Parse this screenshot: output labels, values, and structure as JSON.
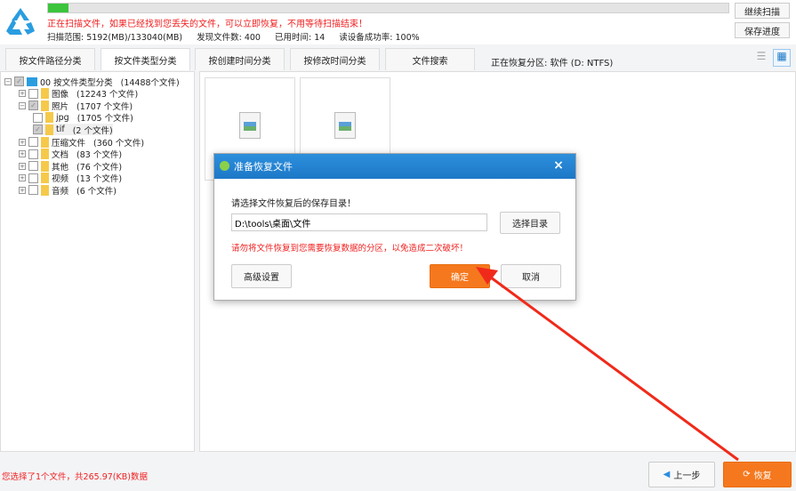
{
  "header": {
    "progress_percent": 3,
    "message": "正在扫描文件，如果已经找到您丢失的文件，可以立即恢复，不用等待扫描结束！",
    "stats": [
      "扫描范围: 5192(MB)/133040(MB)",
      "发现文件数: 400",
      "已用时间: 14",
      "读设备成功率: 100%"
    ],
    "continue_scan": "继续扫描",
    "save_progress": "保存进度"
  },
  "tabs": [
    "按文件路径分类",
    "按文件类型分类",
    "按创建时间分类",
    "按修改时间分类",
    "文件搜索"
  ],
  "partition": "正在恢复分区: 软件 (D: NTFS)",
  "tree": [
    {
      "label": "00 按文件类型分类",
      "count": "(14488个文件)",
      "level": 0,
      "checked": true
    },
    {
      "label": "图像",
      "count": "(12243 个文件)",
      "level": 1,
      "checked": false
    },
    {
      "label": "照片",
      "count": "(1707 个文件)",
      "level": 1,
      "checked": true
    },
    {
      "label": "jpg",
      "count": "(1705 个文件)",
      "level": 2,
      "checked": false
    },
    {
      "label": "tif",
      "count": "(2 个文件)",
      "level": 2,
      "checked": true
    },
    {
      "label": "压缩文件",
      "count": "(360 个文件)",
      "level": 1,
      "checked": false
    },
    {
      "label": "文档",
      "count": "(83 个文件)",
      "level": 1,
      "checked": false
    },
    {
      "label": "其他",
      "count": "(76 个文件)",
      "level": 1,
      "checked": false
    },
    {
      "label": "视频",
      "count": "(13 个文件)",
      "level": 1,
      "checked": false
    },
    {
      "label": "音频",
      "count": "(6 个文件)",
      "level": 1,
      "checked": false
    }
  ],
  "dialog": {
    "title": "准备恢复文件",
    "prompt": "请选择文件恢复后的保存目录！",
    "path": "D:\\tools\\桌面\\文件",
    "browse": "选择目录",
    "warning": "请勿将文件恢复到您需要恢复数据的分区，以免造成二次破坏！",
    "advanced": "高级设置",
    "ok": "确定",
    "cancel": "取消",
    "close": "×"
  },
  "footer": {
    "status": "您选择了1个文件，共265.97(KB)数据",
    "back": "上一步",
    "recover": "恢复"
  },
  "colors": {
    "accent": "#f5781e",
    "title_bar": "#1c78c8",
    "warning": "#f02020"
  }
}
